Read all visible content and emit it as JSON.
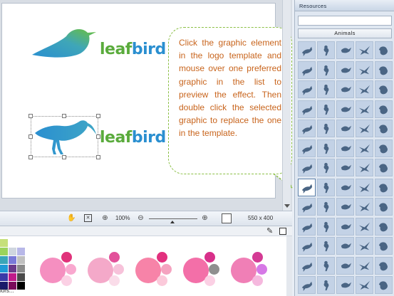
{
  "logos": {
    "top": {
      "word_leaf": "leaf",
      "word_bird": "bird",
      "icon": "songbird-icon"
    },
    "bottom": {
      "word_leaf": "leaf",
      "word_bird": "bird",
      "icon": "curlew-icon"
    }
  },
  "callout": {
    "text": "Click the graphic element in the logo template and mouse over one preferred graphic in the list to preview the effect. Then double click the selected graphic to replace the one in the template."
  },
  "statusbar": {
    "zoom": "100%",
    "canvas_size": "550 x 400",
    "icons": [
      "hand-icon",
      "fit-icon",
      "crosshair-icon",
      "zoom-out-icon",
      "zoom-in-icon"
    ]
  },
  "palette": {
    "colors_label": "lors...",
    "swatches": [
      "#8fd13a",
      "#c6e07a",
      "#ffffff",
      "#ffffff",
      "#5eb84c",
      "#9bd35c",
      "#cfd6df",
      "#b8b8e8",
      "#2f7a3c",
      "#3aa6b8",
      "#7a7ad8",
      "#c0c0c0",
      "#1a5c8a",
      "#1f9ad6",
      "#6a3a8a",
      "#8a8a8a",
      "#0d2f6a",
      "#3a3aa8",
      "#c01a8a",
      "#4a4a4a",
      "#0a1a3a",
      "#1a1a6a",
      "#7a0a5a",
      "#000000"
    ],
    "schemes": [
      {
        "main": "#f58fc0",
        "top": "#e0327a",
        "mid": "#f9a8cf",
        "bottom": "#fbd0e4"
      },
      {
        "main": "#f4a9c9",
        "top": "#e2519a",
        "mid": "#f7c2da",
        "bottom": "#fadce9"
      },
      {
        "main": "#f783a8",
        "top": "#e2307e",
        "mid": "#f5a3c0",
        "bottom": "#fbc9da"
      },
      {
        "main": "#f36fa8",
        "top": "#d8308a",
        "mid": "#8f8f8f",
        "bottom": "#fbd0e4"
      },
      {
        "main": "#f07fb6",
        "top": "#d43a94",
        "mid": "#d678e6",
        "bottom": "#f5b8de"
      }
    ]
  },
  "resources": {
    "title": "Resources",
    "category": "Animals",
    "icon_color": "#4a6584",
    "grid": [
      [
        "gull-icon",
        "stork-icon",
        "ostrich-icon",
        "goose-icon",
        "duck-icon"
      ],
      [
        "swan-icon",
        "eagle-head-icon",
        "flying-bird-icon",
        "eagle-icon",
        "pigeon-icon"
      ],
      [
        "parrot-icon",
        "heron-icon",
        "hawk-icon",
        "swallow-icon",
        "eagle-flight-icon"
      ],
      [
        "crow-icon",
        "gull-flight-icon",
        "bat-icon",
        "rooster-icon",
        "owl-icon"
      ],
      [
        "chicken-icon",
        "flamingo-icon",
        "hen-icon",
        "songbird-icon",
        "sparrow-icon"
      ],
      [
        "dove-icon",
        "bird-flock-icon",
        "swan-flight-icon",
        "pelican-icon",
        "bird-perched-icon"
      ],
      [
        "crane-icon",
        "egret-icon",
        "kingfisher-icon",
        "hummingbird-icon",
        "stork-flight-icon"
      ],
      [
        "curlew-icon",
        "toucan-icon",
        "raven-icon",
        "peacock-icon",
        "finch-icon"
      ],
      [
        "wren-icon",
        "magpie-icon",
        "blackbird-icon",
        "robin-icon",
        "lark-icon"
      ],
      [
        "vulture-icon",
        "cockatoo-icon",
        "pheasant-icon",
        "turkey-icon",
        "quail-icon"
      ],
      [
        "duck-swim-icon",
        "goose-walk-icon",
        "coot-icon",
        "rooster-crow-icon",
        "peahen-icon"
      ],
      [
        "chick-icon",
        "partridge-icon",
        "grouse-icon",
        "mallard-icon",
        "teal-icon"
      ],
      [
        "loon-icon",
        "grebe-icon",
        "puffin-icon",
        "penguin-icon",
        "auk-icon"
      ]
    ]
  }
}
